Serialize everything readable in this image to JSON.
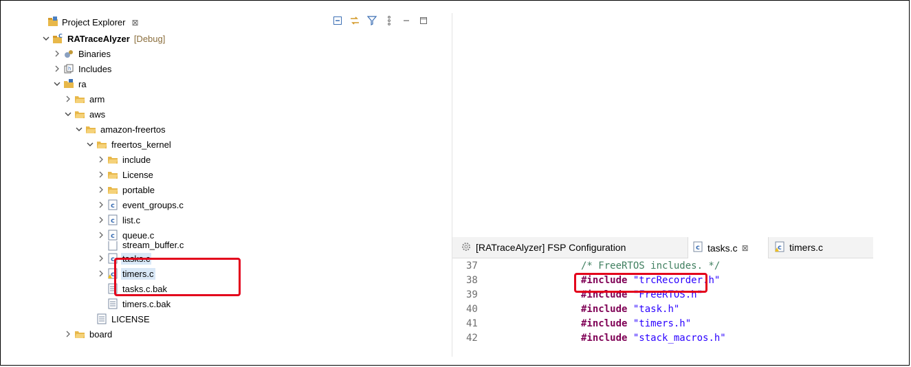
{
  "explorer": {
    "title": "Project Explorer",
    "close_symbol": "⊠",
    "toolbar": [
      "collapse-all-icon",
      "link-with-editor-icon",
      "filter-icon",
      "view-menu-icon",
      "minimize-icon",
      "maximize-icon"
    ],
    "project": {
      "name": "RATraceAlyzer",
      "config": "[Debug]"
    },
    "items": {
      "binaries": "Binaries",
      "includes": "Includes",
      "ra": "ra",
      "arm": "arm",
      "aws": "aws",
      "amazon_freertos": "amazon-freertos",
      "freertos_kernel": "freertos_kernel",
      "include": "include",
      "license_folder": "License",
      "portable": "portable",
      "event_groups": "event_groups.c",
      "list": "list.c",
      "queue": "queue.c",
      "stream_buffer": "stream_buffer.c",
      "tasks": "tasks.c",
      "timers": "timers.c",
      "tasks_bak": "tasks.c.bak",
      "timers_bak": "timers.c.bak",
      "license_file": "LICENSE",
      "board": "board"
    }
  },
  "editor": {
    "tabs": {
      "fsp": "[RATraceAlyzer] FSP Configuration",
      "tasks": "tasks.c",
      "timers": "timers.c"
    },
    "lines": [
      {
        "num": "37",
        "comment": "/* FreeRTOS includes. */"
      },
      {
        "num": "38",
        "directive": "#include",
        "file": "\"trcRecorder.h\""
      },
      {
        "num": "39",
        "directive": "#include",
        "file": "\"FreeRTOS.h\""
      },
      {
        "num": "40",
        "directive": "#include",
        "file": "\"task.h\""
      },
      {
        "num": "41",
        "directive": "#include",
        "file": "\"timers.h\""
      },
      {
        "num": "42",
        "directive": "#include",
        "file": "\"stack_macros.h\""
      }
    ]
  },
  "colors": {
    "highlight": "#e3001b",
    "folder": "#e8b84a",
    "keyword": "#7f0055",
    "string": "#2a00ff",
    "comment": "#3f7f5f"
  }
}
